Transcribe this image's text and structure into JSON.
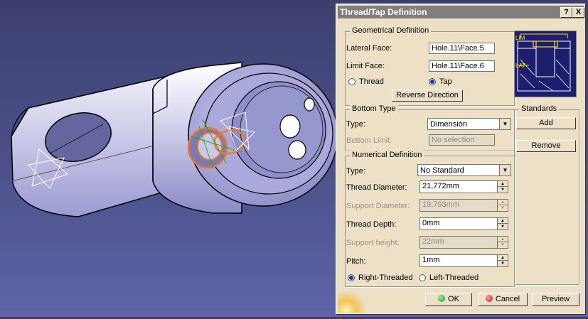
{
  "dialog": {
    "title": "Thread/Tap Definition",
    "help_label": "?",
    "close_label": "X",
    "geometrical": {
      "title": "Geometrical Definition",
      "lateral_face_label": "Lateral Face:",
      "lateral_face_value": "Hole.11\\Face.5",
      "limit_face_label": "Limit Face:",
      "limit_face_value": "Hole.11\\Face.6",
      "thread_label": "Thread",
      "tap_label": "Tap",
      "reverse_direction_label": "Reverse Direction",
      "preview_lim": "LIM",
      "preview_lat": "LAT"
    },
    "bottom_type": {
      "title": "Bottom Type",
      "type_label": "Type:",
      "type_value": "Dimension",
      "bottom_limit_label": "Bottom Limit:",
      "bottom_limit_value": "No selection"
    },
    "standards": {
      "title": "Standards",
      "add_label": "Add",
      "remove_label": "Remove"
    },
    "numerical": {
      "title": "Numerical Definition",
      "type_label": "Type:",
      "type_value": "No Standard",
      "thread_diameter_label": "Thread Diameter:",
      "thread_diameter_value": "21,772mm",
      "support_diameter_label": "Support Diameter:",
      "support_diameter_value": "19,793mm",
      "thread_depth_label": "Thread Depth:",
      "thread_depth_value": "0mm",
      "support_height_label": "Support height:",
      "support_height_value": "22mm",
      "pitch_label": "Pitch:",
      "pitch_value": "1mm",
      "right_threaded_label": "Right-Threaded",
      "left_threaded_label": "Left-Threaded"
    },
    "footer": {
      "ok_label": "OK",
      "cancel_label": "Cancel",
      "preview_label": "Preview"
    }
  },
  "colors": {
    "dialog_bg": "#ece0c6",
    "titlebar": "#7f7f7f",
    "viewport_bg": "#4a4e86",
    "highlight": "#f07a1e",
    "ok_green": "#1a9a2a",
    "cancel_red": "#c82020"
  }
}
